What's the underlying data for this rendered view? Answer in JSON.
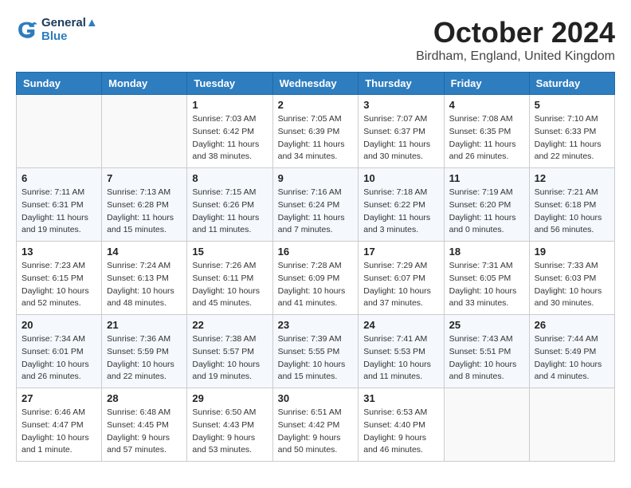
{
  "header": {
    "logo_line1": "General",
    "logo_line2": "Blue",
    "month_title": "October 2024",
    "location": "Birdham, England, United Kingdom"
  },
  "weekdays": [
    "Sunday",
    "Monday",
    "Tuesday",
    "Wednesday",
    "Thursday",
    "Friday",
    "Saturday"
  ],
  "weeks": [
    [
      {
        "day": "",
        "sunrise": "",
        "sunset": "",
        "daylight": ""
      },
      {
        "day": "",
        "sunrise": "",
        "sunset": "",
        "daylight": ""
      },
      {
        "day": "1",
        "sunrise": "Sunrise: 7:03 AM",
        "sunset": "Sunset: 6:42 PM",
        "daylight": "Daylight: 11 hours and 38 minutes."
      },
      {
        "day": "2",
        "sunrise": "Sunrise: 7:05 AM",
        "sunset": "Sunset: 6:39 PM",
        "daylight": "Daylight: 11 hours and 34 minutes."
      },
      {
        "day": "3",
        "sunrise": "Sunrise: 7:07 AM",
        "sunset": "Sunset: 6:37 PM",
        "daylight": "Daylight: 11 hours and 30 minutes."
      },
      {
        "day": "4",
        "sunrise": "Sunrise: 7:08 AM",
        "sunset": "Sunset: 6:35 PM",
        "daylight": "Daylight: 11 hours and 26 minutes."
      },
      {
        "day": "5",
        "sunrise": "Sunrise: 7:10 AM",
        "sunset": "Sunset: 6:33 PM",
        "daylight": "Daylight: 11 hours and 22 minutes."
      }
    ],
    [
      {
        "day": "6",
        "sunrise": "Sunrise: 7:11 AM",
        "sunset": "Sunset: 6:31 PM",
        "daylight": "Daylight: 11 hours and 19 minutes."
      },
      {
        "day": "7",
        "sunrise": "Sunrise: 7:13 AM",
        "sunset": "Sunset: 6:28 PM",
        "daylight": "Daylight: 11 hours and 15 minutes."
      },
      {
        "day": "8",
        "sunrise": "Sunrise: 7:15 AM",
        "sunset": "Sunset: 6:26 PM",
        "daylight": "Daylight: 11 hours and 11 minutes."
      },
      {
        "day": "9",
        "sunrise": "Sunrise: 7:16 AM",
        "sunset": "Sunset: 6:24 PM",
        "daylight": "Daylight: 11 hours and 7 minutes."
      },
      {
        "day": "10",
        "sunrise": "Sunrise: 7:18 AM",
        "sunset": "Sunset: 6:22 PM",
        "daylight": "Daylight: 11 hours and 3 minutes."
      },
      {
        "day": "11",
        "sunrise": "Sunrise: 7:19 AM",
        "sunset": "Sunset: 6:20 PM",
        "daylight": "Daylight: 11 hours and 0 minutes."
      },
      {
        "day": "12",
        "sunrise": "Sunrise: 7:21 AM",
        "sunset": "Sunset: 6:18 PM",
        "daylight": "Daylight: 10 hours and 56 minutes."
      }
    ],
    [
      {
        "day": "13",
        "sunrise": "Sunrise: 7:23 AM",
        "sunset": "Sunset: 6:15 PM",
        "daylight": "Daylight: 10 hours and 52 minutes."
      },
      {
        "day": "14",
        "sunrise": "Sunrise: 7:24 AM",
        "sunset": "Sunset: 6:13 PM",
        "daylight": "Daylight: 10 hours and 48 minutes."
      },
      {
        "day": "15",
        "sunrise": "Sunrise: 7:26 AM",
        "sunset": "Sunset: 6:11 PM",
        "daylight": "Daylight: 10 hours and 45 minutes."
      },
      {
        "day": "16",
        "sunrise": "Sunrise: 7:28 AM",
        "sunset": "Sunset: 6:09 PM",
        "daylight": "Daylight: 10 hours and 41 minutes."
      },
      {
        "day": "17",
        "sunrise": "Sunrise: 7:29 AM",
        "sunset": "Sunset: 6:07 PM",
        "daylight": "Daylight: 10 hours and 37 minutes."
      },
      {
        "day": "18",
        "sunrise": "Sunrise: 7:31 AM",
        "sunset": "Sunset: 6:05 PM",
        "daylight": "Daylight: 10 hours and 33 minutes."
      },
      {
        "day": "19",
        "sunrise": "Sunrise: 7:33 AM",
        "sunset": "Sunset: 6:03 PM",
        "daylight": "Daylight: 10 hours and 30 minutes."
      }
    ],
    [
      {
        "day": "20",
        "sunrise": "Sunrise: 7:34 AM",
        "sunset": "Sunset: 6:01 PM",
        "daylight": "Daylight: 10 hours and 26 minutes."
      },
      {
        "day": "21",
        "sunrise": "Sunrise: 7:36 AM",
        "sunset": "Sunset: 5:59 PM",
        "daylight": "Daylight: 10 hours and 22 minutes."
      },
      {
        "day": "22",
        "sunrise": "Sunrise: 7:38 AM",
        "sunset": "Sunset: 5:57 PM",
        "daylight": "Daylight: 10 hours and 19 minutes."
      },
      {
        "day": "23",
        "sunrise": "Sunrise: 7:39 AM",
        "sunset": "Sunset: 5:55 PM",
        "daylight": "Daylight: 10 hours and 15 minutes."
      },
      {
        "day": "24",
        "sunrise": "Sunrise: 7:41 AM",
        "sunset": "Sunset: 5:53 PM",
        "daylight": "Daylight: 10 hours and 11 minutes."
      },
      {
        "day": "25",
        "sunrise": "Sunrise: 7:43 AM",
        "sunset": "Sunset: 5:51 PM",
        "daylight": "Daylight: 10 hours and 8 minutes."
      },
      {
        "day": "26",
        "sunrise": "Sunrise: 7:44 AM",
        "sunset": "Sunset: 5:49 PM",
        "daylight": "Daylight: 10 hours and 4 minutes."
      }
    ],
    [
      {
        "day": "27",
        "sunrise": "Sunrise: 6:46 AM",
        "sunset": "Sunset: 4:47 PM",
        "daylight": "Daylight: 10 hours and 1 minute."
      },
      {
        "day": "28",
        "sunrise": "Sunrise: 6:48 AM",
        "sunset": "Sunset: 4:45 PM",
        "daylight": "Daylight: 9 hours and 57 minutes."
      },
      {
        "day": "29",
        "sunrise": "Sunrise: 6:50 AM",
        "sunset": "Sunset: 4:43 PM",
        "daylight": "Daylight: 9 hours and 53 minutes."
      },
      {
        "day": "30",
        "sunrise": "Sunrise: 6:51 AM",
        "sunset": "Sunset: 4:42 PM",
        "daylight": "Daylight: 9 hours and 50 minutes."
      },
      {
        "day": "31",
        "sunrise": "Sunrise: 6:53 AM",
        "sunset": "Sunset: 4:40 PM",
        "daylight": "Daylight: 9 hours and 46 minutes."
      },
      {
        "day": "",
        "sunrise": "",
        "sunset": "",
        "daylight": ""
      },
      {
        "day": "",
        "sunrise": "",
        "sunset": "",
        "daylight": ""
      }
    ]
  ]
}
